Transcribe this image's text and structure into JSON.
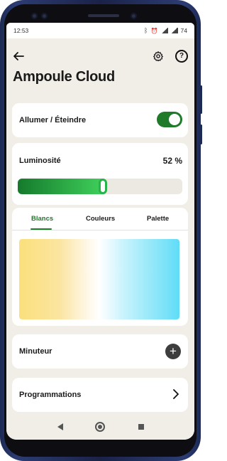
{
  "status": {
    "time": "12:53",
    "battery": "74"
  },
  "header": {
    "title": "Ampoule Cloud"
  },
  "power": {
    "label": "Allumer / Éteindre",
    "on": true
  },
  "brightness": {
    "label": "Luminosité",
    "value_text": "52 %",
    "value": 0.52
  },
  "color_tabs": {
    "tabs": [
      {
        "label": "Blancs"
      },
      {
        "label": "Couleurs"
      },
      {
        "label": "Palette"
      }
    ],
    "active": "Blancs"
  },
  "timer": {
    "label": "Minuteur",
    "add_symbol": "+"
  },
  "schedules": {
    "label": "Programmations"
  },
  "icons": {
    "back": "back-arrow-icon",
    "settings": "gear-icon",
    "help": "help-icon",
    "add": "plus-icon",
    "chevron": "chevron-right-icon"
  },
  "colors": {
    "accent": "#1f7a2a",
    "accent_light": "#3fcf5a",
    "background": "#f1eee7"
  }
}
